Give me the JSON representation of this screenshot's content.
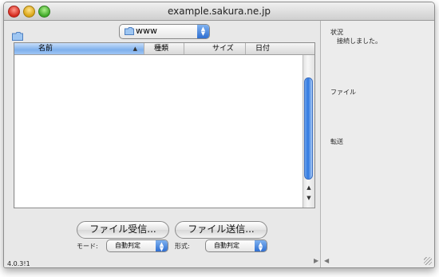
{
  "window": {
    "title": "example.sakura.ne.jp"
  },
  "directory_popup": {
    "value": "www"
  },
  "file_list": {
    "columns": [
      {
        "label": "名前",
        "sorted": "ascending"
      },
      {
        "label": "種類"
      },
      {
        "label": "サイズ"
      },
      {
        "label": "日付"
      }
    ],
    "rows": []
  },
  "buttons": {
    "receive": "ファイル受信...",
    "send": "ファイル送信..."
  },
  "options": {
    "mode_label": "モード:",
    "mode_value": "自動判定",
    "format_label": "形式:",
    "format_value": "自動判定"
  },
  "status_panel": {
    "status_label": "状況",
    "status_value": "接続しました。",
    "file_label": "ファイル",
    "transfer_label": "転送"
  },
  "version": "4.0.3!1",
  "colors": {
    "accent": "#2f6fd1",
    "selected_header": "#7fb0ec"
  }
}
